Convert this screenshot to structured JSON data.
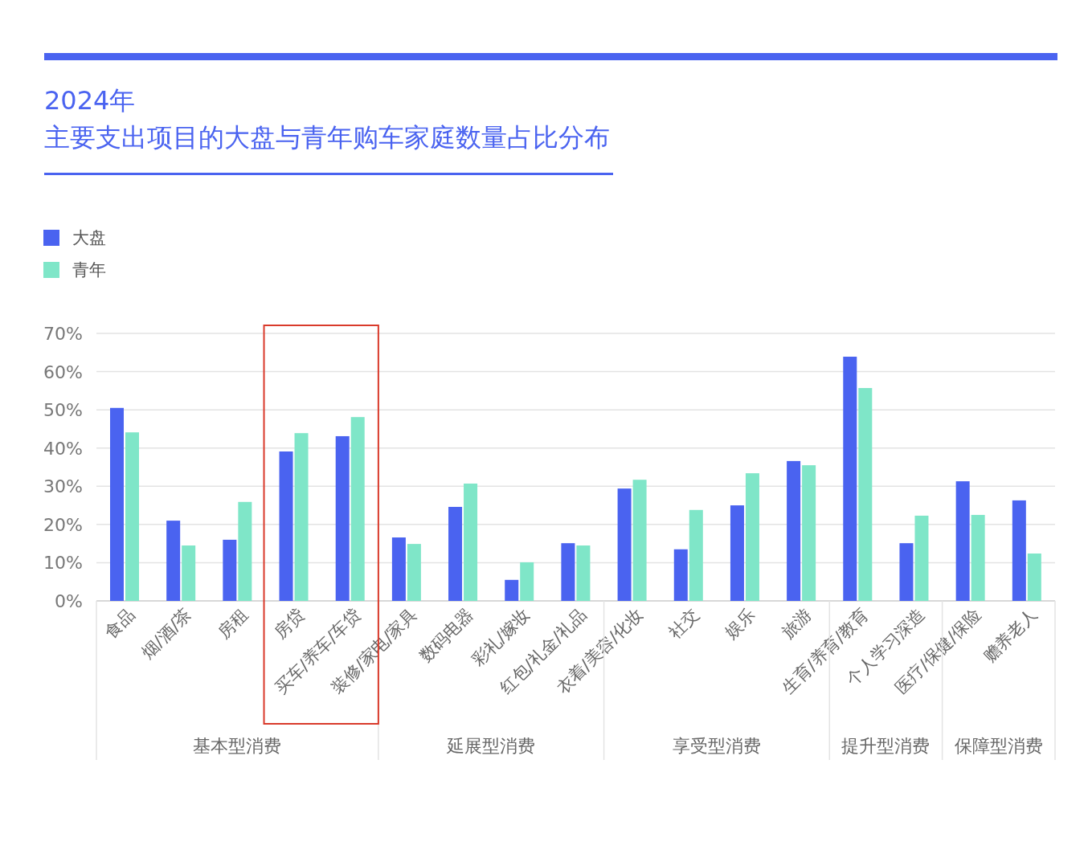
{
  "title": {
    "year": "2024年",
    "subtitle": "主要支出项目的大盘与青年购车家庭数量占比分布"
  },
  "chart": {
    "chart_data": {
      "type": "bar",
      "categories": [
        "食品",
        "烟/酒/茶",
        "房租",
        "房贷",
        "买车/养车/车贷",
        "装修/家电/家具",
        "数码电器",
        "彩礼/嫁妆",
        "红包/礼金/礼品",
        "衣着/美容/化妆",
        "社交",
        "娱乐",
        "旅游",
        "生育/养育/教育",
        "个人学习深造",
        "医疗/保健/保险",
        "赡养老人"
      ],
      "series": [
        {
          "name": "大盘",
          "color": "#4a63f0",
          "values": [
            50.5,
            21.0,
            16.0,
            39.1,
            43.1,
            16.6,
            24.6,
            5.5,
            15.1,
            29.4,
            13.5,
            25.0,
            36.6,
            63.9,
            15.1,
            31.3,
            26.3
          ]
        },
        {
          "name": "青年",
          "color": "#7fe6c8",
          "values": [
            44.1,
            14.5,
            25.9,
            43.9,
            48.1,
            14.9,
            30.7,
            10.1,
            14.5,
            31.7,
            23.8,
            33.4,
            35.5,
            55.7,
            22.3,
            22.5,
            12.4
          ]
        }
      ],
      "ylim": [
        0,
        70
      ],
      "yticks": [
        {
          "value": 0,
          "label": "0%"
        },
        {
          "value": 10,
          "label": "10%"
        },
        {
          "value": 20,
          "label": "20%"
        },
        {
          "value": 30,
          "label": "30%"
        },
        {
          "value": 40,
          "label": "40%"
        },
        {
          "value": 50,
          "label": "50%"
        },
        {
          "value": 60,
          "label": "60%"
        },
        {
          "value": 70,
          "label": "70%"
        }
      ],
      "grid": true
    },
    "highlight_frame": {
      "color": "#d93a2b"
    },
    "category_groups": [
      {
        "label": "基本型消费"
      },
      {
        "label": "延展型消费"
      },
      {
        "label": "享受型消费"
      },
      {
        "label": "提升型消费"
      },
      {
        "label": "保障型消费"
      }
    ]
  }
}
